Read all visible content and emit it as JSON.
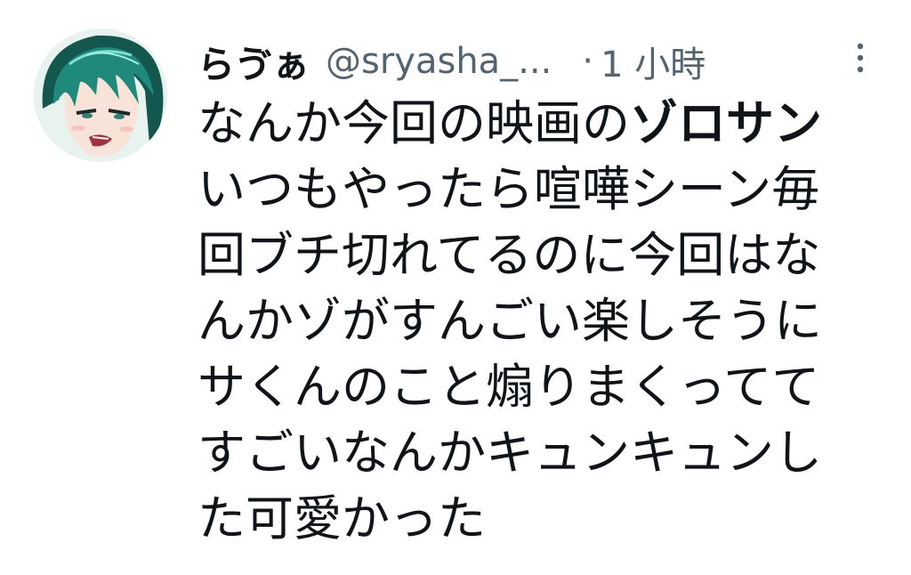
{
  "tweet": {
    "author": {
      "display_name": "らゔぁ",
      "handle": "@sryasha_...",
      "avatar_icon": "user-avatar-icon"
    },
    "separator": "·",
    "timestamp": "1 小時",
    "more_icon": "more-vertical-icon",
    "text": {
      "line1_prefix": "なんか今回の映画の",
      "line1_bold": "ゾロサン",
      "line2": "いつもやったら喧嘩シーン毎",
      "line3": "回ブチ切れてるのに今回はな",
      "line4": "んかゾがすんごい楽しそうに",
      "line5": "サくんのこと煽りまくってて",
      "line6": "すごいなんかキュンキュンし",
      "line7": "た可愛かった"
    }
  },
  "colors": {
    "text_primary": "#0f1419",
    "text_secondary": "#536471",
    "background": "#ffffff",
    "avatar_hair": "#1f7a6e"
  }
}
